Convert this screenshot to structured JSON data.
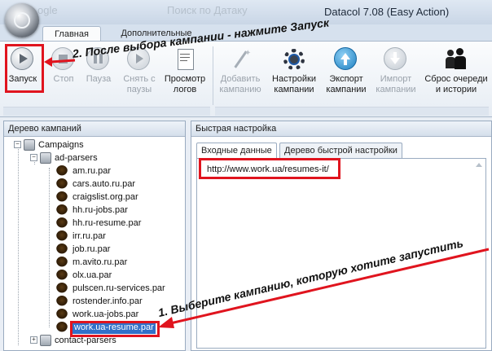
{
  "window": {
    "title": "Datacol 7.08 (Easy Action)",
    "ghost_left": "ogle",
    "ghost_center": "Поиск по Датаку"
  },
  "ribbon_tabs": [
    {
      "label": "Главная",
      "active": true
    },
    {
      "label": "Дополнительные",
      "active": false
    }
  ],
  "ribbon": {
    "start": {
      "label": "Запуск",
      "icon": "play-icon"
    },
    "stop": {
      "label": "Стоп",
      "icon": "stop-icon"
    },
    "pause": {
      "label": "Пауза",
      "icon": "pause-icon"
    },
    "unpause": {
      "label": "Снять с паузы",
      "line1": "Снять с",
      "line2": "паузы",
      "icon": "resume-icon"
    },
    "logs": {
      "label": "Просмотр логов",
      "line1": "Просмотр",
      "line2": "логов",
      "icon": "log-icon"
    },
    "add_campaign": {
      "line1": "Добавить",
      "line2": "кампанию",
      "icon": "magic-wand-icon"
    },
    "campaign_settings": {
      "line1": "Настройки",
      "line2": "кампании",
      "icon": "gear-icon"
    },
    "export_campaign": {
      "line1": "Экспорт",
      "line2": "кампании",
      "icon": "arrow-up-icon"
    },
    "import_campaign": {
      "line1": "Импорт",
      "line2": "кампании",
      "icon": "arrow-down-icon"
    },
    "reset_queue": {
      "line1": "Сброс очереди",
      "line2": "и истории",
      "icon": "people-icon"
    }
  },
  "tree_panel": {
    "title": "Дерево кампаний",
    "root": "Campaigns",
    "group1": "ad-parsers",
    "items": [
      "am.ru.par",
      "cars.auto.ru.par",
      "craigslist.org.par",
      "hh.ru-jobs.par",
      "hh.ru-resume.par",
      "irr.ru.par",
      "job.ru.par",
      "m.avito.ru.par",
      "olx.ua.par",
      "pulscen.ru-services.par",
      "rostender.info.par",
      "work.ua-jobs.par",
      "work.ua-resume.par"
    ],
    "selected": "work.ua-resume.par",
    "group2": "contact-parsers"
  },
  "quick_panel": {
    "title": "Быстрая настройка",
    "tabs": [
      "Входные данные",
      "Дерево быстрой настройки"
    ],
    "input_value": "http://www.work.ua/resumes-it/"
  },
  "annotations": {
    "step2": "2. После выбора кампании - нажмите Запуск",
    "step1": "1. Выберите кампанию, которую хотите запустить"
  },
  "colors": {
    "annotation_red": "#e0141e",
    "selection": "#3270c8"
  }
}
